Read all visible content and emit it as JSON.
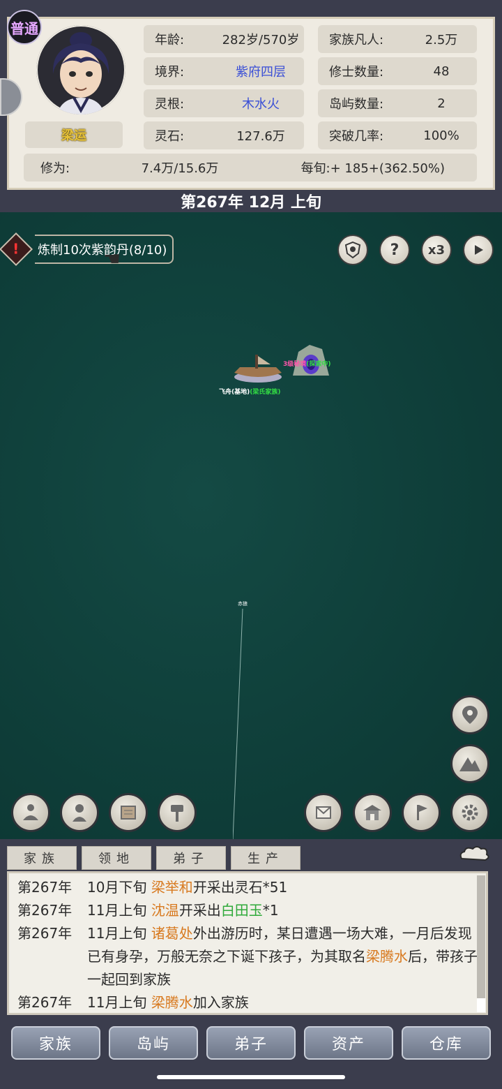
{
  "header": {
    "rank_badge": "普通",
    "character_name": "梁运",
    "stats_left": [
      {
        "label": "年龄:",
        "value": "282岁/570岁"
      },
      {
        "label": "境界:",
        "value": "紫府四层"
      },
      {
        "label": "灵根:",
        "value": "木水火"
      },
      {
        "label": "灵石:",
        "value": "127.6万"
      }
    ],
    "stats_right": [
      {
        "label": "家族凡人:",
        "value": "2.5万"
      },
      {
        "label": "修士数量:",
        "value": "48"
      },
      {
        "label": "岛屿数量:",
        "value": "2"
      },
      {
        "label": "突破几率:",
        "value": "100%"
      }
    ],
    "cultivation_label": "修为:",
    "cultivation_value": "7.4万/15.6万",
    "per_period": "每旬:+ 185+(362.50%)"
  },
  "date": "第267年 12月 上旬",
  "quest": {
    "text": "炼制10次紫韵丹(8/10)"
  },
  "map_controls": {
    "speed": "x3",
    "help": "?"
  },
  "map_labels": {
    "airship": "飞舟(基地)",
    "airship_owner": "(梁氏家族)",
    "secret_realm": "3级秘境",
    "secret_status": "(探索中)",
    "small_marker": "赤狼"
  },
  "log_tabs": [
    "家族",
    "领地",
    "弟子",
    "生产"
  ],
  "log": [
    {
      "year": "第267年",
      "parts": [
        {
          "t": "10月下旬 "
        },
        {
          "t": "梁举和",
          "c": "hl"
        },
        {
          "t": "开采出灵石*51"
        }
      ]
    },
    {
      "year": "第267年",
      "parts": [
        {
          "t": "11月上旬 "
        },
        {
          "t": "沈温",
          "c": "hl"
        },
        {
          "t": "开采出"
        },
        {
          "t": "白田玉",
          "c": "hg"
        },
        {
          "t": "*1"
        }
      ]
    },
    {
      "year": "第267年",
      "parts": [
        {
          "t": "11月上旬 "
        },
        {
          "t": "诸葛处",
          "c": "hl"
        },
        {
          "t": "外出游历时，某日遭遇一场大难，一月后发现已有身孕，万般无奈之下诞下孩子，为其取名"
        },
        {
          "t": "梁腾水",
          "c": "hl"
        },
        {
          "t": "后，带孩子一起回到家族"
        }
      ]
    },
    {
      "year": "第267年",
      "parts": [
        {
          "t": "11月上旬 "
        },
        {
          "t": "梁腾水",
          "c": "hl"
        },
        {
          "t": "加入家族"
        }
      ]
    }
  ],
  "bottom_nav": [
    "家族",
    "岛屿",
    "弟子",
    "资产",
    "仓库"
  ],
  "colors": {
    "accent_blue": "#3a4fd6",
    "name_orange": "#d87a20",
    "item_green": "#2faa3a",
    "map_green": "#0f3f3a"
  }
}
